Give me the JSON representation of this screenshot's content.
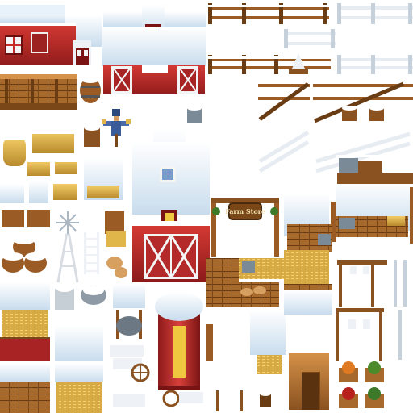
{
  "sprite_sheet": {
    "background": "#ffffff",
    "sign_text": "Farm Store",
    "palette": {
      "snow": "#f3f8fc",
      "snow_shadow": "#b8d2e6",
      "barn_red": "#c62b2b",
      "barn_dark": "#7c1414",
      "wood": "#b8742e",
      "wood_dark": "#6a3c14",
      "fence_white": "#eef2f6",
      "hay": "#e0b54a",
      "stone": "#8e9aa6",
      "pumpkin": "#e07a22",
      "leaf": "#4d8a2c",
      "apple": "#b8201c"
    }
  }
}
